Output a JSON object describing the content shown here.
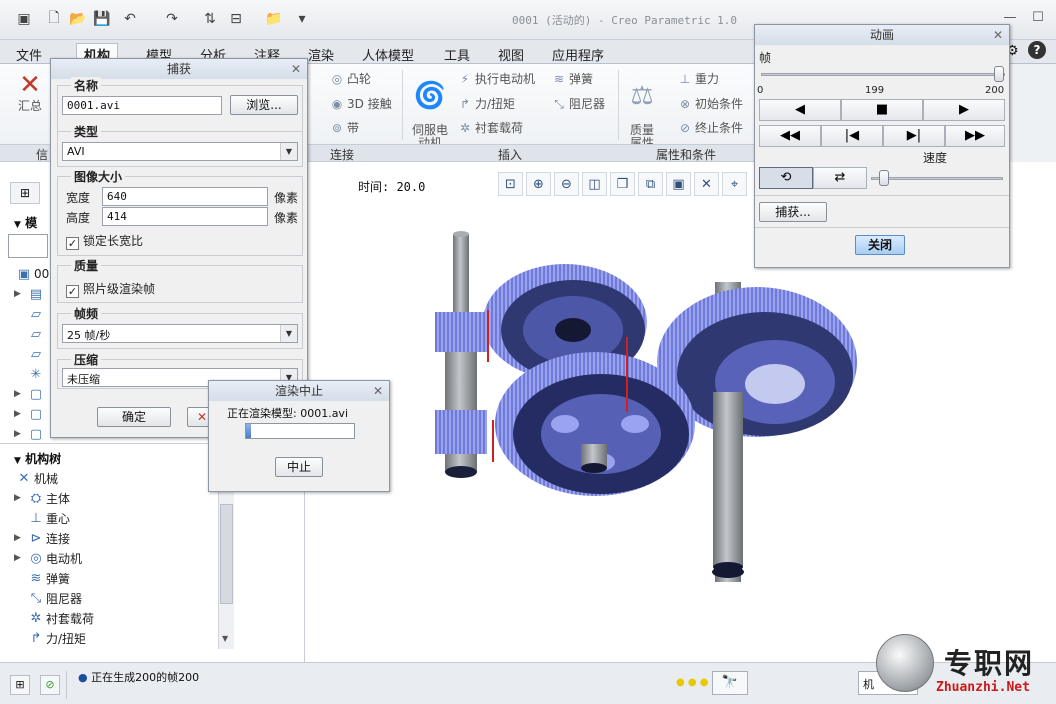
{
  "window": {
    "title": "0001 (活动的) - Creo Parametric 1.0"
  },
  "tabs": [
    "文件",
    "机构",
    "模型",
    "分析",
    "注释",
    "渲染",
    "人体模型",
    "工具",
    "视图",
    "应用程序"
  ],
  "ribbon": {
    "left_button": "汇总",
    "cam": "凸轮",
    "contact3d": "3D 接触",
    "belt": "带",
    "servo": "伺服电\n动机",
    "exec_motor": "执行电动机",
    "force_torque": "力/扭矩",
    "bushing": "衬套载荷",
    "spring": "弹簧",
    "damper": "阻尼器",
    "mass": "质量\n属性",
    "gravity": "重力",
    "init_cond": "初始条件",
    "term_cond": "终止条件",
    "groups": {
      "info": "信",
      "connect": "连接",
      "insert": "插入",
      "props": "属性和条件"
    }
  },
  "graphics": {
    "time_label": "时间: 20.0"
  },
  "tree": {
    "model_header": "模",
    "mech_header": "机构树",
    "mech_items": [
      "机械",
      "主体",
      "重心",
      "连接",
      "电动机",
      "弹簧",
      "阻尼器",
      "衬套载荷",
      "力/扭矩"
    ],
    "top_item": "00"
  },
  "status": {
    "message": "正在生成200的帧200",
    "right_text": "机"
  },
  "capture": {
    "title": "捕获",
    "name_label": "名称",
    "name_value": "0001.avi",
    "browse": "浏览...",
    "type_label": "类型",
    "type_value": "AVI",
    "size_label": "图像大小",
    "width_label": "宽度",
    "width_value": "640",
    "height_label": "高度",
    "height_value": "414",
    "unit": "像素",
    "lock_ratio": "锁定长宽比",
    "quality_label": "质量",
    "photo_render": "照片级渲染帧",
    "fps_label": "帧频",
    "fps_value": "25 帧/秒",
    "compress_label": "压缩",
    "compress_value": "未压缩",
    "ok": "确定"
  },
  "render": {
    "title": "渲染中止",
    "message": "正在渲染模型:  0001.avi",
    "stop": "中止",
    "progress": 0.05
  },
  "animation": {
    "title": "动画",
    "frame_label": "帧",
    "min": "0",
    "current": "199",
    "max": "200",
    "current_value": 199,
    "max_value": 200,
    "speed_label": "速度",
    "capture_btn": "捕获...",
    "close_btn": "关闭"
  },
  "watermark": {
    "cn": "专职网",
    "url": "Zhuanzhi.Net"
  },
  "colors": {
    "gear": "#7e8ae8",
    "gear_dark": "#2a3370",
    "shaft": "#8f9499",
    "accent": "#d02020"
  }
}
